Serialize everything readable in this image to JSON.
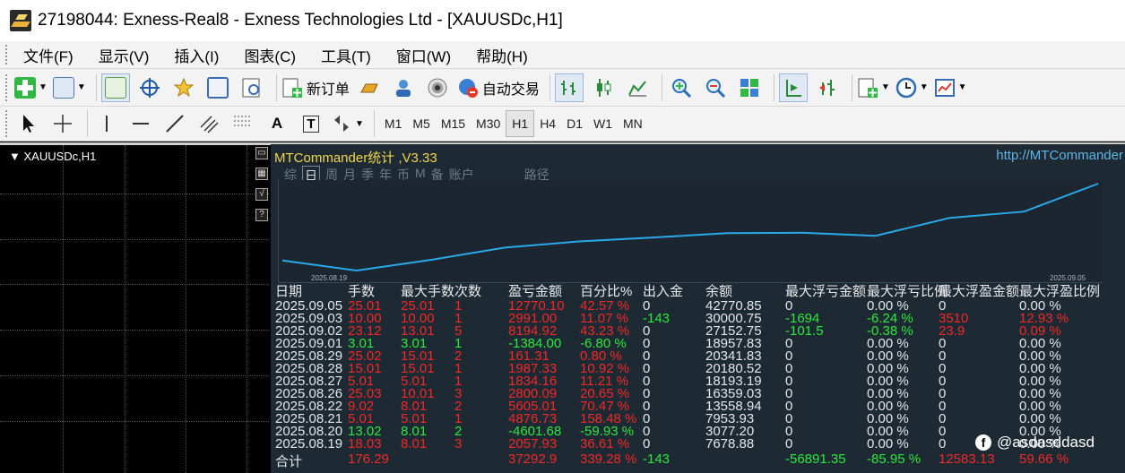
{
  "window": {
    "title": "27198044: Exness-Real8 - Exness Technologies Ltd - [XAUUSDc,H1]"
  },
  "menu": [
    "文件(F)",
    "显示(V)",
    "插入(I)",
    "图表(C)",
    "工具(T)",
    "窗口(W)",
    "帮助(H)"
  ],
  "toolbar": {
    "new_order": "新订单",
    "auto_trading": "自动交易",
    "timeframes": [
      "M1",
      "M5",
      "M15",
      "M30",
      "H1",
      "H4",
      "D1",
      "W1",
      "MN"
    ],
    "active_timeframe": "H1",
    "text_tool": "A",
    "text_label_tool": "T"
  },
  "chart": {
    "symbol_label": "XAUUSDc,H1"
  },
  "panel": {
    "title": "MTCommander统计 ,V3.33",
    "url": "http://MTCommander",
    "tabs": [
      "综",
      "日",
      "周",
      "月",
      "季",
      "年",
      "币",
      "M",
      "备",
      "账户"
    ],
    "selected_tab": "日",
    "extra_tab": "路径",
    "graph": {
      "start_date": "2025.08.19",
      "end_date": "2025.09.05",
      "line_color": "#2aa9e8"
    },
    "table": {
      "headers": [
        "日期",
        "手数",
        "最大手数",
        "次数",
        "盈亏金额",
        "百分比%",
        "出入金",
        "余额",
        "最大浮亏金额",
        "最大浮亏比例",
        "最大浮盈金额",
        "最大浮盈比例"
      ],
      "rows": [
        [
          "2025.09.05",
          "25.01",
          "25.01",
          "1",
          "12770.10",
          "42.57 %",
          "0",
          "42770.85",
          "0",
          "0.00 %",
          "0",
          "0.00 %"
        ],
        [
          "2025.09.03",
          "10.00",
          "10.00",
          "1",
          "2991.00",
          "11.07 %",
          "-143",
          "30000.75",
          "-1694",
          "-6.24 %",
          "3510",
          "12.93 %"
        ],
        [
          "2025.09.02",
          "23.12",
          "13.01",
          "5",
          "8194.92",
          "43.23 %",
          "0",
          "27152.75",
          "-101.5",
          "-0.38 %",
          "23.9",
          "0.09 %"
        ],
        [
          "2025.09.01",
          "3.01",
          "3.01",
          "1",
          "-1384.00",
          "-6.80 %",
          "0",
          "18957.83",
          "0",
          "0.00 %",
          "0",
          "0.00 %"
        ],
        [
          "2025.08.29",
          "25.02",
          "15.01",
          "2",
          "161.31",
          "0.80 %",
          "0",
          "20341.83",
          "0",
          "0.00 %",
          "0",
          "0.00 %"
        ],
        [
          "2025.08.28",
          "15.01",
          "15.01",
          "1",
          "1987.33",
          "10.92 %",
          "0",
          "20180.52",
          "0",
          "0.00 %",
          "0",
          "0.00 %"
        ],
        [
          "2025.08.27",
          "5.01",
          "5.01",
          "1",
          "1834.16",
          "11.21 %",
          "0",
          "18193.19",
          "0",
          "0.00 %",
          "0",
          "0.00 %"
        ],
        [
          "2025.08.26",
          "25.03",
          "10.01",
          "3",
          "2800.09",
          "20.65 %",
          "0",
          "16359.03",
          "0",
          "0.00 %",
          "0",
          "0.00 %"
        ],
        [
          "2025.08.22",
          "9.02",
          "8.01",
          "2",
          "5605.01",
          "70.47 %",
          "0",
          "13558.94",
          "0",
          "0.00 %",
          "0",
          "0.00 %"
        ],
        [
          "2025.08.21",
          "5.01",
          "5.01",
          "1",
          "4876.73",
          "158.48 %",
          "0",
          "7953.93",
          "0",
          "0.00 %",
          "0",
          "0.00 %"
        ],
        [
          "2025.08.20",
          "13.02",
          "8.01",
          "2",
          "-4601.68",
          "-59.93 %",
          "0",
          "3077.20",
          "0",
          "0.00 %",
          "0",
          "0.00 %"
        ],
        [
          "2025.08.19",
          "18.03",
          "8.01",
          "3",
          "2057.93",
          "36.61 %",
          "0",
          "7678.88",
          "0",
          "0.00 %",
          "0",
          "0.00 %"
        ]
      ],
      "row_colors": [
        "red",
        "red",
        "red",
        "green",
        "red",
        "red",
        "red",
        "red",
        "red",
        "red",
        "green",
        "red"
      ],
      "total": {
        "label": "合计",
        "lots": "176.29",
        "profit": "37292.9",
        "percent": "339.28 %",
        "deposit": "-143",
        "max_float_loss": "-56891.35",
        "max_float_loss_pct": "-85.95 %",
        "max_float_profit": "12583.13",
        "max_float_profit_pct": "59.66 %"
      }
    }
  },
  "watermark": {
    "text": "@asdasddasd",
    "icon": "facebook-icon"
  }
}
